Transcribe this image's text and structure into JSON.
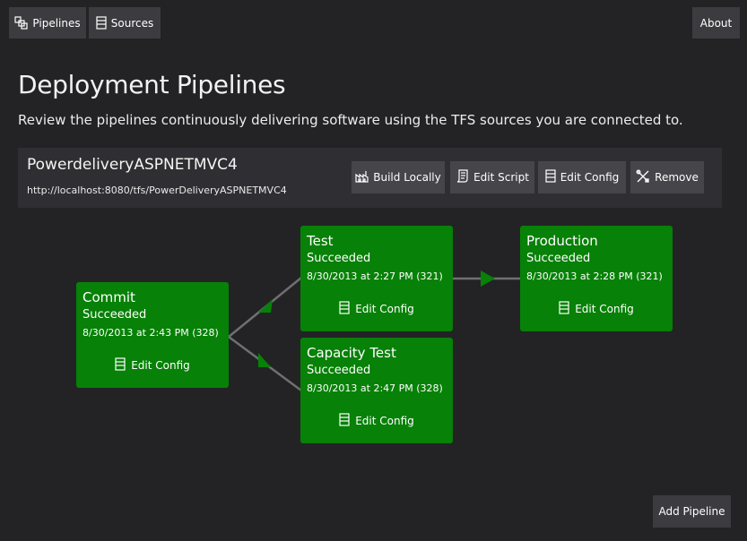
{
  "nav": {
    "pipelines_label": "Pipelines",
    "sources_label": "Sources",
    "about_label": "About"
  },
  "page": {
    "title": "Deployment Pipelines",
    "subtitle": "Review the pipelines continuously delivering software using the TFS sources you are connected to."
  },
  "pipeline": {
    "name": "PowerdeliveryASPNETMVC4",
    "url": "http://localhost:8080/tfs/PowerDeliveryASPNETMVC4",
    "actions": {
      "build_locally": "Build Locally",
      "edit_script": "Edit Script",
      "edit_config": "Edit Config",
      "remove": "Remove"
    },
    "stages": {
      "commit": {
        "name": "Commit",
        "status": "Succeeded",
        "time": "8/30/2013 at 2:43 PM (328)",
        "edit_label": "Edit Config"
      },
      "test": {
        "name": "Test",
        "status": "Succeeded",
        "time": "8/30/2013 at 2:27 PM (321)",
        "edit_label": "Edit Config"
      },
      "capacity_test": {
        "name": "Capacity Test",
        "status": "Succeeded",
        "time": "8/30/2013 at 2:47 PM (328)",
        "edit_label": "Edit Config"
      },
      "production": {
        "name": "Production",
        "status": "Succeeded",
        "time": "8/30/2013 at 2:28 PM (321)",
        "edit_label": "Edit Config"
      }
    }
  },
  "footer": {
    "add_pipeline_label": "Add Pipeline"
  },
  "colors": {
    "background": "#232325",
    "button": "#3c3c40",
    "stage_success": "#078107",
    "connector": "#6f6f73"
  },
  "icons": {
    "pipelines": "pipelines-icon",
    "sources": "server-icon",
    "build": "factory-icon",
    "script": "scroll-icon",
    "config": "server-icon",
    "remove": "tools-icon"
  }
}
